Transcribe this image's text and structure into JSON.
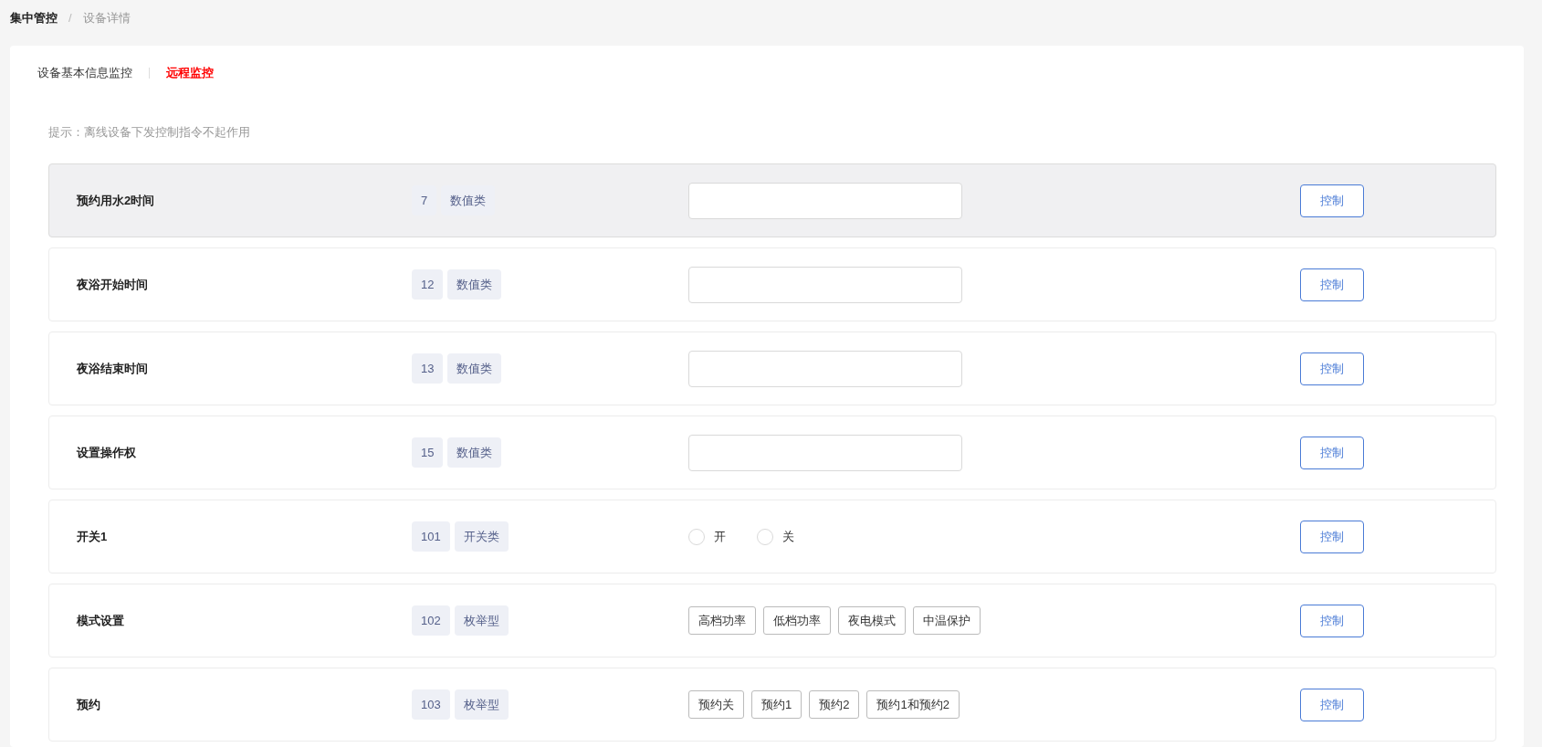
{
  "breadcrumb_separator": "/",
  "breadcrumb": [
    {
      "label": "集中管控",
      "current": false
    },
    {
      "label": "设备详情",
      "current": true
    }
  ],
  "tabs": [
    {
      "label": "设备基本信息监控",
      "selected": false
    },
    {
      "label": "远程监控",
      "selected": true
    }
  ],
  "tip": "提示：离线设备下发控制指令不起作用",
  "rows": [
    {
      "name": "预约用水2时间",
      "code": "7",
      "type": "数值类",
      "kind": "input",
      "hovered": true,
      "button": "控制"
    },
    {
      "name": "夜浴开始时间",
      "code": "12",
      "type": "数值类",
      "kind": "input",
      "hovered": false,
      "button": "控制"
    },
    {
      "name": "夜浴结束时间",
      "code": "13",
      "type": "数值类",
      "kind": "input",
      "hovered": false,
      "button": "控制"
    },
    {
      "name": "设置操作权",
      "code": "15",
      "type": "数值类",
      "kind": "input",
      "hovered": false,
      "button": "控制"
    },
    {
      "name": "开关1",
      "code": "101",
      "type": "开关类",
      "kind": "radio",
      "hovered": false,
      "button": "控制",
      "options": [
        {
          "label": "开",
          "selected": false
        },
        {
          "label": "关",
          "selected": false
        }
      ]
    },
    {
      "name": "模式设置",
      "code": "102",
      "type": "枚举型",
      "kind": "options",
      "hovered": false,
      "button": "控制",
      "options": [
        {
          "label": "高档功率",
          "selected": false
        },
        {
          "label": "低档功率",
          "selected": false
        },
        {
          "label": "夜电模式",
          "selected": false
        },
        {
          "label": "中温保护",
          "selected": false
        }
      ]
    },
    {
      "name": "预约",
      "code": "103",
      "type": "枚举型",
      "kind": "options",
      "hovered": false,
      "button": "控制",
      "options": [
        {
          "label": "预约关",
          "selected": false
        },
        {
          "label": "预约1",
          "selected": false
        },
        {
          "label": "预约2",
          "selected": false
        },
        {
          "label": "预约1和预约2",
          "selected": false
        }
      ]
    }
  ]
}
